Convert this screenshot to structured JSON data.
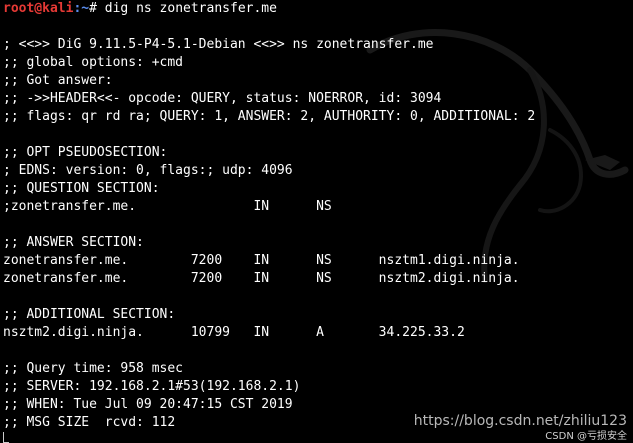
{
  "prompt": {
    "user_host": "root@kali",
    "path": ":~",
    "symbol": "# ",
    "command": "dig ns zonetransfer.me"
  },
  "output_lines": [
    "",
    "; <<>> DiG 9.11.5-P4-5.1-Debian <<>> ns zonetransfer.me",
    ";; global options: +cmd",
    ";; Got answer:",
    ";; ->>HEADER<<- opcode: QUERY, status: NOERROR, id: 3094",
    ";; flags: qr rd ra; QUERY: 1, ANSWER: 2, AUTHORITY: 0, ADDITIONAL: 2",
    "",
    ";; OPT PSEUDOSECTION:",
    "; EDNS: version: 0, flags:; udp: 4096",
    ";; QUESTION SECTION:",
    ";zonetransfer.me.               IN      NS",
    "",
    ";; ANSWER SECTION:",
    "zonetransfer.me.        7200    IN      NS      nsztm1.digi.ninja.",
    "zonetransfer.me.        7200    IN      NS      nsztm2.digi.ninja.",
    "",
    ";; ADDITIONAL SECTION:",
    "nsztm2.digi.ninja.      10799   IN      A       34.225.33.2",
    "",
    ";; Query time: 958 msec",
    ";; SERVER: 192.168.2.1#53(192.168.2.1)",
    ";; WHEN: Tue Jul 09 20:47:15 CST 2019",
    ";; MSG SIZE  rcvd: 112"
  ],
  "watermark": "https://blog.csdn.net/zhiliu123",
  "watermark_secondary": "CSDN @亏损安全",
  "colors": {
    "background": "#000000",
    "text": "#ffffff",
    "prompt_user": "#e53935",
    "prompt_path": "#5a8dee"
  }
}
